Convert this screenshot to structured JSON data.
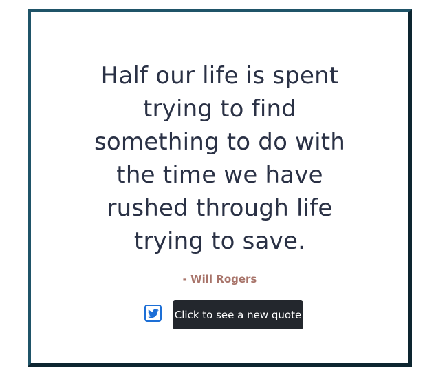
{
  "quote": {
    "text": "Half our life is spent trying to find something to do with the time we have rushed through life trying to save.",
    "author": "- Will Rogers"
  },
  "actions": {
    "tweet_icon": "twitter-icon",
    "new_quote_label": "Click to see a new quote"
  },
  "colors": {
    "border": "#1f5468",
    "quote_text": "#2a3145",
    "author_text": "#a8746a",
    "tweet_icon": "#1d6fd6",
    "button_bg": "#23272d"
  }
}
